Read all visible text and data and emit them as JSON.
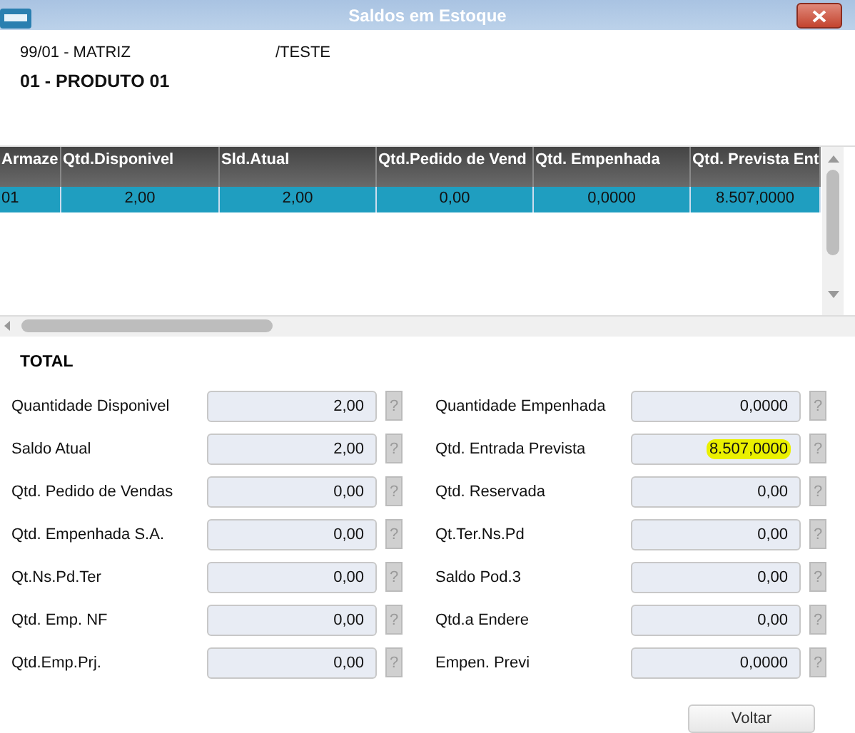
{
  "window": {
    "title": "Saldos em Estoque"
  },
  "info": {
    "branch": "99/01 - MATRIZ",
    "suffix": "/TESTE",
    "product": "01 - PRODUTO 01"
  },
  "table": {
    "columns": [
      "Armaze",
      "Qtd.Disponivel",
      "Sld.Atual",
      "Qtd.Pedido de Vend",
      "Qtd. Empenhada",
      "Qtd. Prevista Ent"
    ],
    "rows": [
      {
        "selected": true,
        "cells": [
          "01",
          "2,00",
          "2,00",
          "0,00",
          "0,0000",
          "8.507,0000"
        ]
      }
    ]
  },
  "totals": {
    "title": "TOTAL",
    "fields": [
      {
        "label": "Quantidade Disponivel",
        "value": "2,00",
        "highlighted": false
      },
      {
        "label": "Quantidade Empenhada",
        "value": "0,0000",
        "highlighted": false
      },
      {
        "label": "Saldo Atual",
        "value": "2,00",
        "highlighted": false
      },
      {
        "label": "Qtd. Entrada Prevista",
        "value": "8.507,0000",
        "highlighted": true
      },
      {
        "label": "Qtd. Pedido de Vendas",
        "value": "0,00",
        "highlighted": false
      },
      {
        "label": "Qtd. Reservada",
        "value": "0,00",
        "highlighted": false
      },
      {
        "label": "Qtd. Empenhada S.A.",
        "value": "0,00",
        "highlighted": false
      },
      {
        "label": "Qt.Ter.Ns.Pd",
        "value": "0,00",
        "highlighted": false
      },
      {
        "label": "Qt.Ns.Pd.Ter",
        "value": "0,00",
        "highlighted": false
      },
      {
        "label": "Saldo Pod.3",
        "value": "0,00",
        "highlighted": false
      },
      {
        "label": "Qtd. Emp. NF",
        "value": "0,00",
        "highlighted": false
      },
      {
        "label": "Qtd.a Endere",
        "value": "0,00",
        "highlighted": false
      },
      {
        "label": "Qtd.Emp.Prj.",
        "value": "0,00",
        "highlighted": false
      },
      {
        "label": "Empen. Previ",
        "value": "0,0000",
        "highlighted": false
      }
    ],
    "help": "?"
  },
  "buttons": [
    "Voltar"
  ]
}
